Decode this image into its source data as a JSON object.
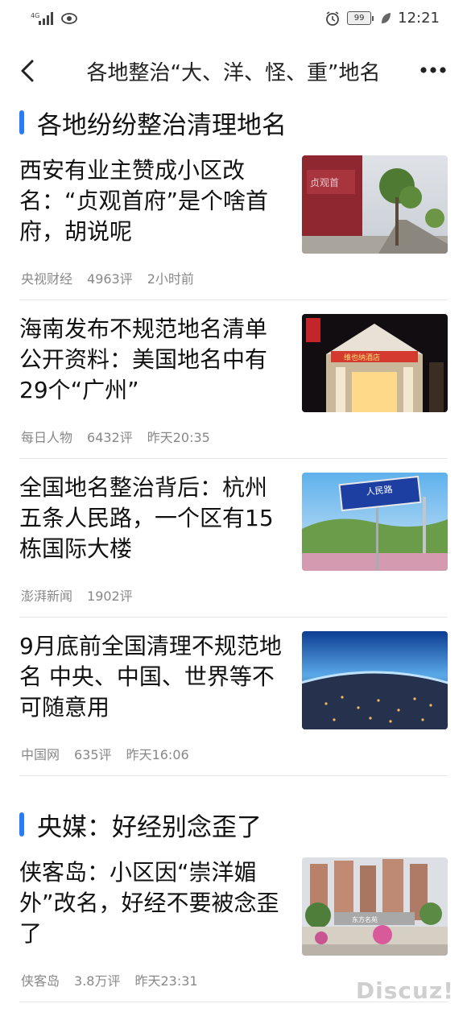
{
  "status_bar": {
    "network": "4G",
    "battery": "99",
    "time": "12:21"
  },
  "nav": {
    "title": "各地整治“大、洋、怪、重”地名"
  },
  "sections": [
    {
      "title": "各地纷纷整治清理地名",
      "articles": [
        {
          "title": "西安有业主赞成小区改名：“贞观首府”是个啥首府，胡说呢",
          "source": "央视财经",
          "comments": "4963评",
          "time": "2小时前",
          "thumb_icon": "street-photo"
        },
        {
          "title": "海南发布不规范地名清单公开资料：美国地名中有29个“广州”",
          "source": "每日人物",
          "comments": "6432评",
          "time": "昨天20:35",
          "thumb_icon": "hotel-photo"
        },
        {
          "title": "全国地名整治背后：杭州五条人民路，一个区有15栋国际大楼",
          "source": "澎湃新闻",
          "comments": "1902评",
          "time": "",
          "thumb_icon": "road-sign-photo"
        },
        {
          "title": "9月底前全国清理不规范地名 中央、中国、世界等不可随意用",
          "source": "中国网",
          "comments": "635评",
          "time": "昨天16:06",
          "thumb_icon": "city-aerial-photo"
        }
      ]
    },
    {
      "title": "央媒：好经别念歪了",
      "articles": [
        {
          "title": "侠客岛：小区因“崇洋媚外”改名，好经不要被念歪了",
          "source": "侠客岛",
          "comments": "3.8万评",
          "time": "昨天23:31",
          "thumb_icon": "residential-photo"
        }
      ]
    }
  ],
  "watermark": "Discuz!",
  "colors": {
    "accent": "#2b7cf2",
    "meta": "#888888",
    "divider": "#e6e6e6"
  }
}
